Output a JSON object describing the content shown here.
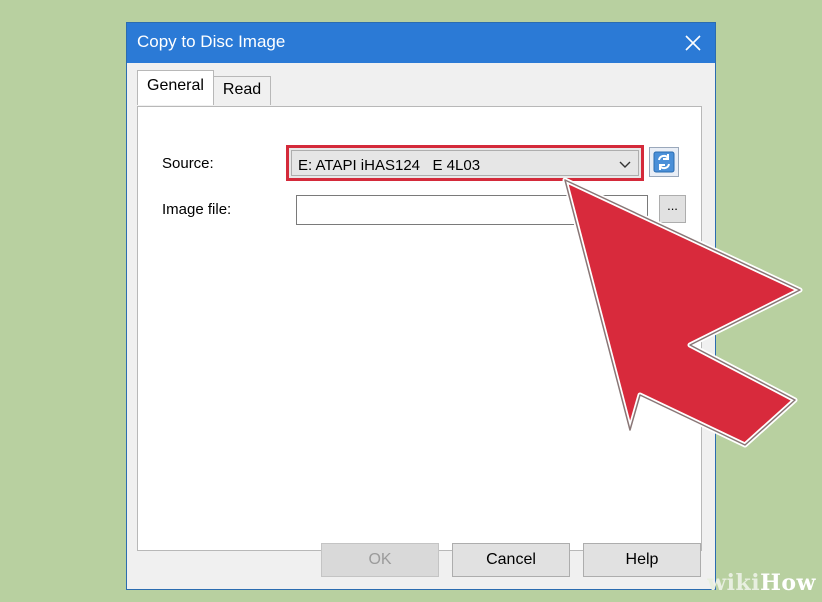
{
  "window": {
    "title": "Copy to Disc Image"
  },
  "tabs": [
    {
      "label": "General",
      "active": true
    },
    {
      "label": "Read",
      "active": false
    }
  ],
  "form": {
    "source_label": "Source:",
    "source_value": "E: ATAPI iHAS124   E 4L03",
    "image_file_label": "Image file:",
    "image_file_value": "",
    "browse_label": "..."
  },
  "buttons": {
    "ok": "OK",
    "cancel": "Cancel",
    "help": "Help"
  },
  "watermark": {
    "text_part1": "wiki",
    "text_part2": "How"
  },
  "colors": {
    "titlebar": "#2b7ad6",
    "highlight_box": "#d42a3a",
    "arrow": "#d82a3c",
    "background": "#b8d0a0"
  },
  "icons": {
    "close": "close-icon",
    "dropdown": "chevron-down-icon",
    "refresh": "refresh-icon",
    "pointer": "arrow-pointer-icon"
  }
}
